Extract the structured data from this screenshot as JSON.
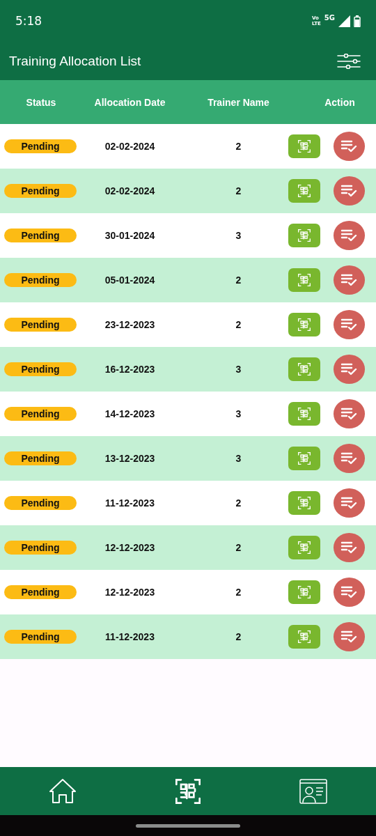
{
  "status_bar": {
    "time": "5:18",
    "volte_top": "Vo",
    "volte_bottom": "LTE",
    "network": "5G"
  },
  "app_bar": {
    "title": "Training Allocation List"
  },
  "table": {
    "columns": [
      "Status",
      "Allocation Date",
      "Trainer Name",
      "Action"
    ],
    "rows": [
      {
        "status": "Pending",
        "date": "02-02-2024",
        "trainer": "2"
      },
      {
        "status": "Pending",
        "date": "02-02-2024",
        "trainer": "2"
      },
      {
        "status": "Pending",
        "date": "30-01-2024",
        "trainer": "3"
      },
      {
        "status": "Pending",
        "date": "05-01-2024",
        "trainer": "2"
      },
      {
        "status": "Pending",
        "date": "23-12-2023",
        "trainer": "2"
      },
      {
        "status": "Pending",
        "date": "16-12-2023",
        "trainer": "3"
      },
      {
        "status": "Pending",
        "date": "14-12-2023",
        "trainer": "3"
      },
      {
        "status": "Pending",
        "date": "13-12-2023",
        "trainer": "3"
      },
      {
        "status": "Pending",
        "date": "11-12-2023",
        "trainer": "2"
      },
      {
        "status": "Pending",
        "date": "12-12-2023",
        "trainer": "2"
      },
      {
        "status": "Pending",
        "date": "12-12-2023",
        "trainer": "2"
      },
      {
        "status": "Pending",
        "date": "11-12-2023",
        "trainer": "2"
      }
    ]
  },
  "bottom_nav": [
    {
      "kind": "home"
    },
    {
      "kind": "scan"
    },
    {
      "kind": "profile"
    }
  ]
}
